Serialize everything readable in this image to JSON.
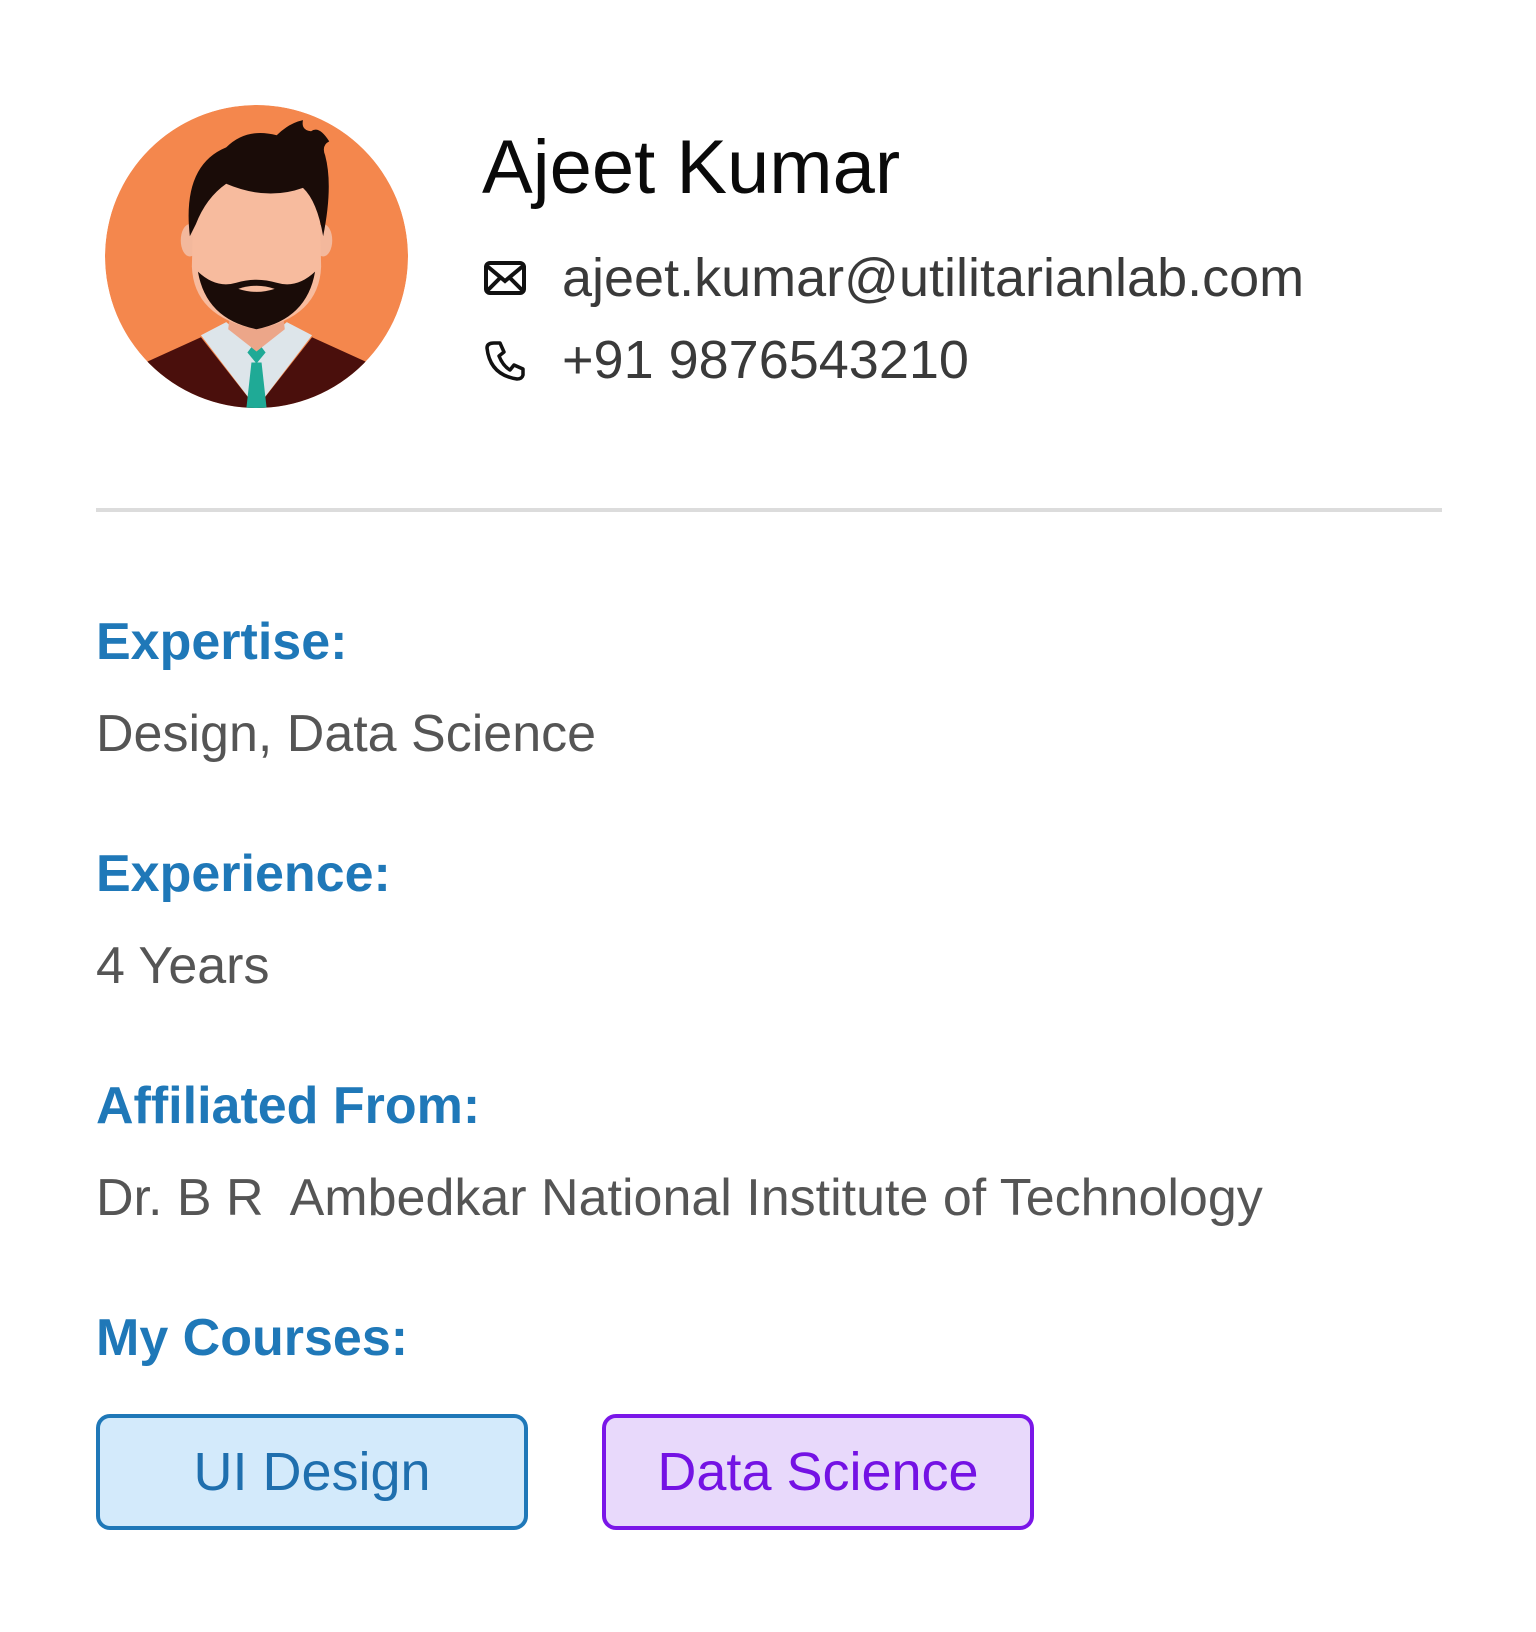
{
  "profile": {
    "name": "Ajeet Kumar",
    "email": "ajeet.kumar@utilitarianlab.com",
    "phone": "+91 9876543210",
    "avatar_icon": "man-with-beard-avatar-icon",
    "email_icon": "envelope-icon",
    "phone_icon": "phone-icon"
  },
  "sections": {
    "expertise": {
      "label": "Expertise:",
      "value": "Design, Data Science"
    },
    "experience": {
      "label": "Experience:",
      "value": "4 Years"
    },
    "affiliation": {
      "label": "Affiliated From:",
      "value": "Dr. B R  Ambedkar National Institute of Technology"
    },
    "courses": {
      "label": "My Courses:",
      "items": [
        {
          "label": "UI Design"
        },
        {
          "label": "Data Science"
        }
      ]
    }
  },
  "colors": {
    "heading_blue": "#1f78b8",
    "value_gray": "#555555",
    "chip_ui_bg": "#d3eafb",
    "chip_ds_bg": "#e8d9fb",
    "chip_ds_border": "#7a16e8",
    "avatar_bg": "#f4874d"
  }
}
